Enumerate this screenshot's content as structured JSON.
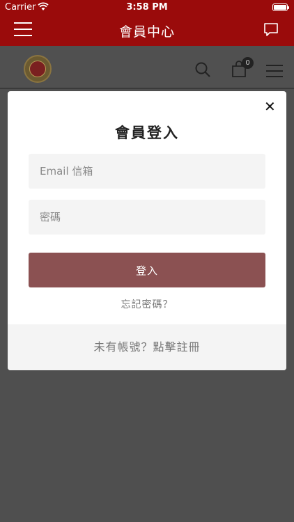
{
  "status_bar": {
    "carrier": "Carrier",
    "time": "3:58 PM",
    "battery_level": 1.0
  },
  "nav_bar": {
    "title": "會員中心"
  },
  "header": {
    "cart_count": "0"
  },
  "login_modal": {
    "title": "會員登入",
    "email_placeholder": "Email 信箱",
    "password_placeholder": "密碼",
    "submit_label": "登入",
    "forgot_password": "忘記密碼？",
    "register_prompt": "未有帳號？點擊註冊"
  },
  "colors": {
    "brand_red": "#9a0b0b",
    "button_accent": "#8b5152",
    "overlay_gray": "#4f4f4f"
  }
}
